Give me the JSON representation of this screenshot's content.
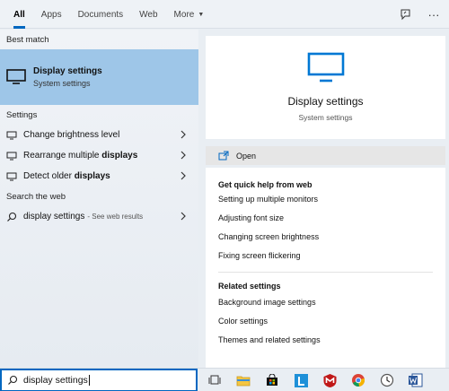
{
  "tabs": [
    {
      "label": "All",
      "active": true
    },
    {
      "label": "Apps"
    },
    {
      "label": "Documents"
    },
    {
      "label": "Web"
    },
    {
      "label": "More",
      "has_dropdown": true
    }
  ],
  "top_icons": [
    "feedback-icon",
    "more-options-icon"
  ],
  "left": {
    "best_match_header": "Best match",
    "best_match": {
      "title": "Display settings",
      "subtitle": "System settings",
      "icon": "monitor-icon"
    },
    "settings_header": "Settings",
    "settings_items": [
      {
        "icon": "brightness-icon",
        "text": "Change brightness level",
        "bold": ""
      },
      {
        "icon": "monitor-icon",
        "text": "Rearrange multiple ",
        "bold": "displays"
      },
      {
        "icon": "monitor-icon",
        "text": "Detect older ",
        "bold": "displays"
      }
    ],
    "web_header": "Search the web",
    "web_item": {
      "icon": "search-icon",
      "query": "display settings",
      "suffix": "- See web results"
    }
  },
  "right": {
    "app_title": "Display settings",
    "app_subtitle": "System settings",
    "open_label": "Open",
    "quick_help_header": "Get quick help from web",
    "quick_help_links": [
      "Setting up multiple monitors",
      "Adjusting font size",
      "Changing screen brightness",
      "Fixing screen flickering"
    ],
    "related_header": "Related settings",
    "related_links": [
      "Background image settings",
      "Color settings",
      "Themes and related settings"
    ]
  },
  "taskbar": {
    "search_value": "display settings",
    "icons": [
      "task-view-icon",
      "file-explorer-icon",
      "store-icon",
      "launcher-l-icon",
      "mcafee-icon",
      "chrome-icon",
      "clock-app-icon",
      "word-icon"
    ]
  },
  "colors": {
    "accent": "#0067c0",
    "selected_bg": "#9ec6e8",
    "monitor_blue": "#0078d4"
  }
}
